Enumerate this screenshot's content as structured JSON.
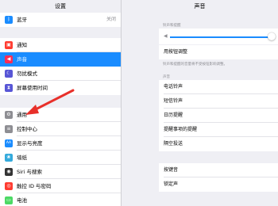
{
  "left": {
    "title": "设置",
    "items": [
      {
        "icon": "bluetooth-icon",
        "glyph": "ᛒ",
        "color": "#1a8cff",
        "label": "蓝牙",
        "value": "关闭"
      },
      {
        "icon": "notifications-icon",
        "glyph": "▣",
        "color": "#ff3b30",
        "label": "通知"
      },
      {
        "icon": "sounds-icon",
        "glyph": "◀",
        "color": "#ff2d55",
        "label": "声音",
        "selected": true
      },
      {
        "icon": "do-not-disturb-icon",
        "glyph": "☾",
        "color": "#5856d6",
        "label": "勿扰模式"
      },
      {
        "icon": "screen-time-icon",
        "glyph": "⧗",
        "color": "#5856d6",
        "label": "屏幕使用时间"
      },
      {
        "icon": "general-icon",
        "glyph": "⚙",
        "color": "#8e8e93",
        "label": "通用"
      },
      {
        "icon": "control-center-icon",
        "glyph": "≡",
        "color": "#8e8e93",
        "label": "控制中心"
      },
      {
        "icon": "display-icon",
        "glyph": "AA",
        "color": "#1a8cff",
        "label": "显示与亮度"
      },
      {
        "icon": "wallpaper-icon",
        "glyph": "❀",
        "color": "#34aadc",
        "label": "墙纸"
      },
      {
        "icon": "siri-icon",
        "glyph": "◉",
        "color": "#333333",
        "label": "Siri 与搜索"
      },
      {
        "icon": "touch-id-icon",
        "glyph": "◎",
        "color": "#ff3b30",
        "label": "触控 ID 与密码"
      },
      {
        "icon": "battery-icon",
        "glyph": "▭",
        "color": "#4cd964",
        "label": "电池"
      }
    ]
  },
  "right": {
    "title": "声音",
    "ringer_header": "铃声和提醒",
    "volume": 0.95,
    "change_with_buttons": "用按钮调整",
    "change_note": "铃声和提醒的音量将不受按钮影响调整。",
    "sounds_header": "声音",
    "sound_items": [
      "电话铃声",
      "短信铃声",
      "日历提醒",
      "提醒事项的提醒",
      "隔空投送"
    ],
    "keyboard_clicks": "按键音",
    "lock_sound": "锁定声"
  },
  "colors": {
    "accent": "#1a8cff",
    "arrow": "#e8302a"
  }
}
